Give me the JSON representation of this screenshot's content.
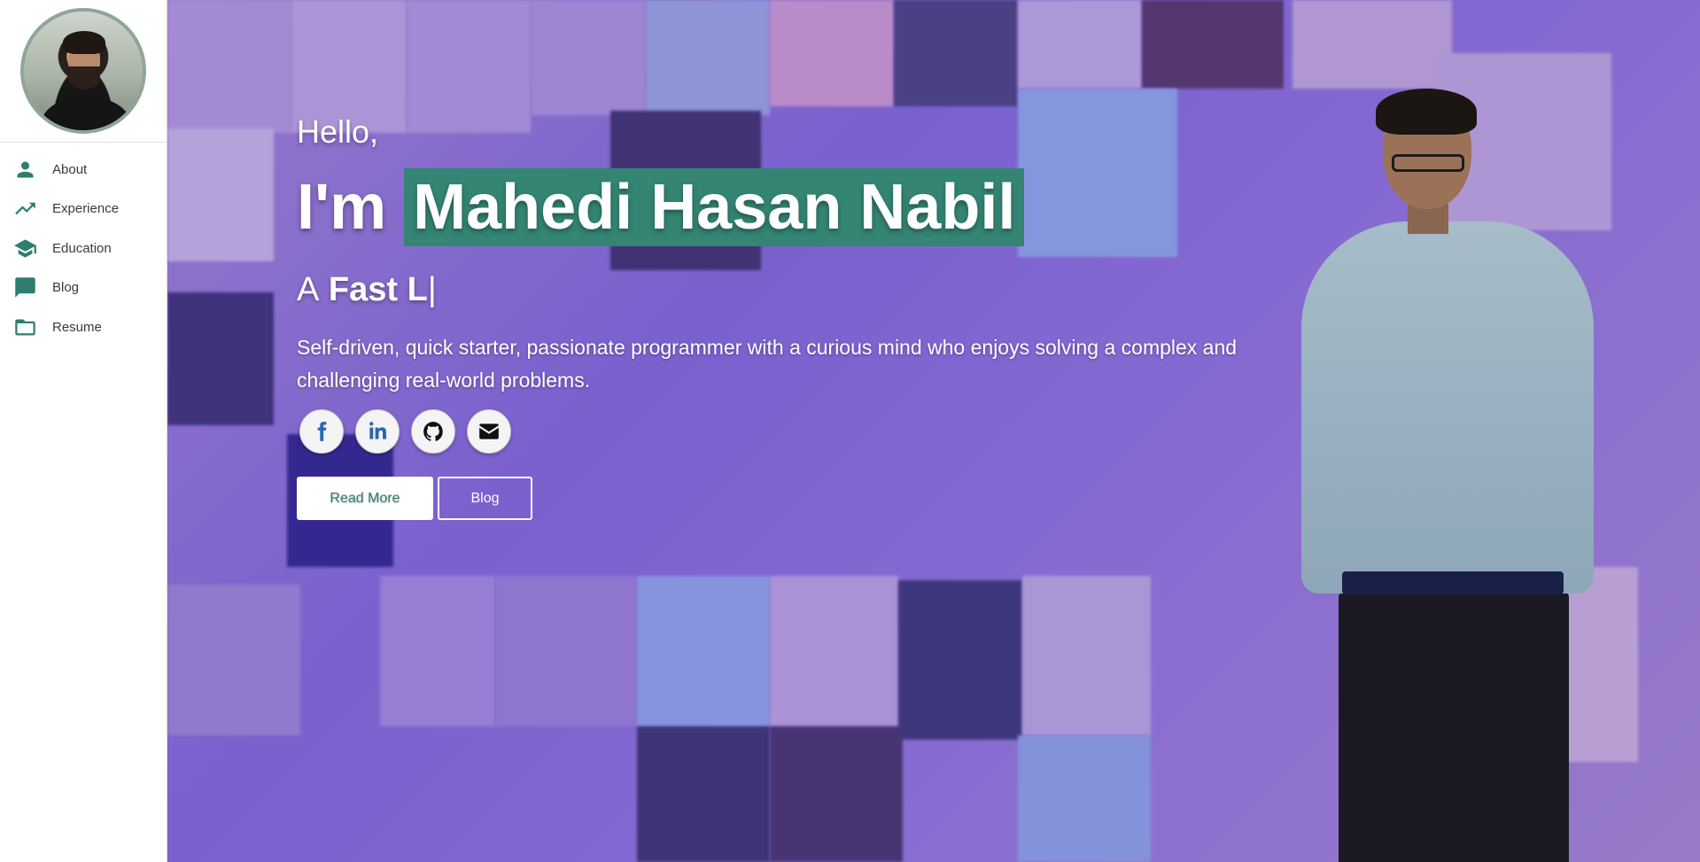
{
  "sidebar": {
    "nav": [
      {
        "label": "About",
        "icon": "person-icon"
      },
      {
        "label": "Experience",
        "icon": "trending-up-icon"
      },
      {
        "label": "Education",
        "icon": "graduation-cap-icon"
      },
      {
        "label": "Blog",
        "icon": "list-icon"
      },
      {
        "label": "Resume",
        "icon": "folder-icon"
      }
    ]
  },
  "hero": {
    "greeting": "Hello,",
    "im": "I'm",
    "name": "Mahedi Hasan Nabil",
    "role_prefix": "A",
    "role_typed": "Fast L",
    "role_cursor": "|",
    "description": "Self-driven, quick starter, passionate programmer with a curious mind who enjoys solving a complex and challenging real-world problems.",
    "socials": [
      {
        "name": "facebook-icon",
        "color": "#2b67b1"
      },
      {
        "name": "linkedin-icon",
        "color": "#2b67b1"
      },
      {
        "name": "github-icon",
        "color": "#111111"
      },
      {
        "name": "email-icon",
        "color": "#111111"
      }
    ],
    "buttons": {
      "read_more": "Read More",
      "blog": "Blog"
    }
  },
  "colors": {
    "accent": "#348574",
    "icon": "#2e7d6e"
  }
}
